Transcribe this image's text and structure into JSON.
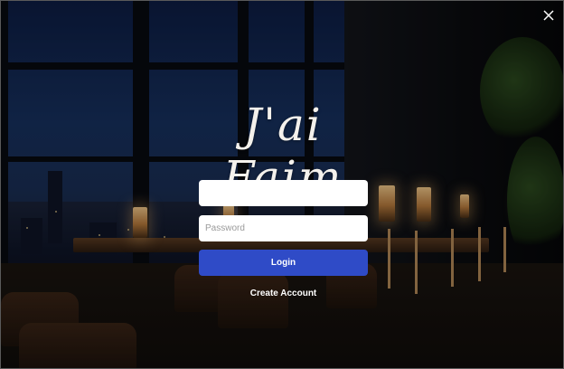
{
  "window": {
    "close_icon": "close-icon"
  },
  "brand": {
    "title": "J'ai Faim"
  },
  "form": {
    "username": {
      "value": "",
      "placeholder": ""
    },
    "password": {
      "value": "",
      "placeholder": "Password"
    },
    "login_label": "Login",
    "create_account_label": "Create Account"
  },
  "colors": {
    "login_button": "#2f4bc7",
    "field_background": "#ffffff",
    "text_light": "#ffffff"
  }
}
